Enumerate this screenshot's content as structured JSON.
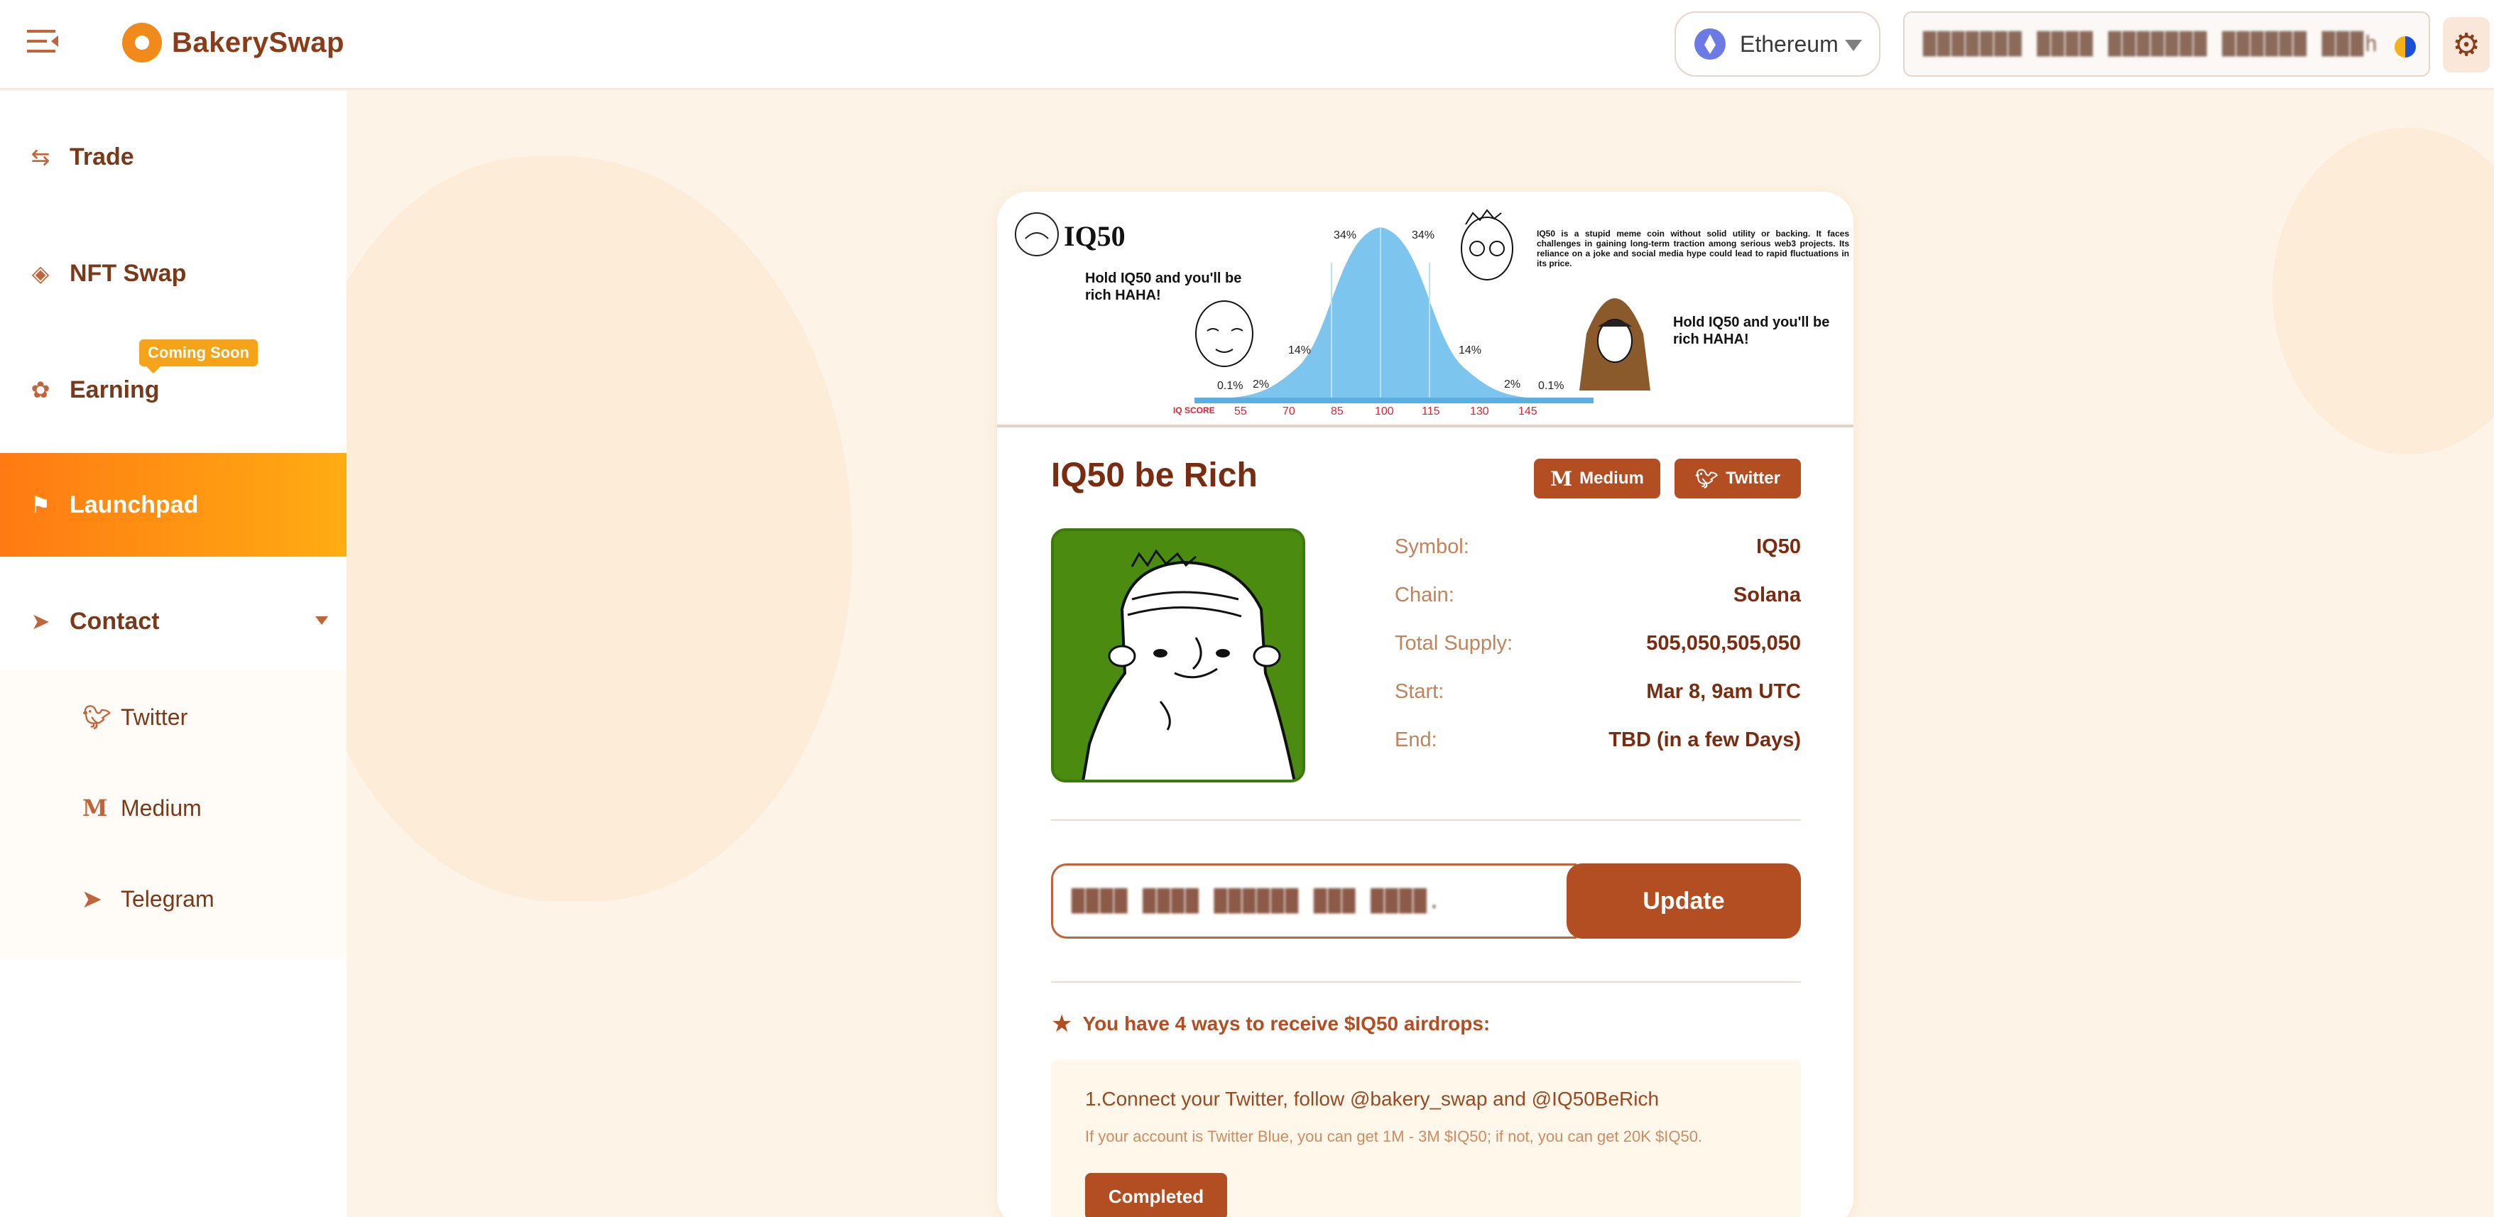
{
  "header": {
    "brand": "BakerySwap",
    "chain": "Ethereum",
    "wallet_address": "███████ ████ ███████ ██████ ███h"
  },
  "sidebar": {
    "items": [
      {
        "label": "Trade",
        "icon": "swap-icon"
      },
      {
        "label": "NFT Swap",
        "icon": "nft-icon"
      },
      {
        "label": "Earning",
        "icon": "earning-icon",
        "badge": "Coming Soon"
      },
      {
        "label": "Launchpad",
        "icon": "flag-icon"
      },
      {
        "label": "Contact",
        "icon": "send-icon"
      }
    ],
    "contact_links": [
      {
        "label": "Twitter",
        "icon": "twitter-icon"
      },
      {
        "label": "Medium",
        "icon": "medium-icon"
      },
      {
        "label": "Telegram",
        "icon": "telegram-icon"
      }
    ]
  },
  "banner": {
    "brand": "IQ50",
    "left_caption": "Hold IQ50 and you'll be rich HAHA!",
    "right_caption": "Hold IQ50 and you'll be rich HAHA!",
    "disclaimer": "IQ50 is a stupid meme coin without solid utility or backing. It faces challenges in gaining long-term traction among serious web3 projects. Its reliance on a joke and social media hype could lead to rapid fluctuations in its price.",
    "axis_label": "IQ SCORE",
    "ticks": [
      "55",
      "70",
      "85",
      "100",
      "115",
      "130",
      "145"
    ],
    "percents": [
      "0.1%",
      "2%",
      "14%",
      "34%",
      "34%",
      "14%",
      "2%",
      "0.1%"
    ]
  },
  "project": {
    "title": "IQ50 be Rich",
    "medium_label": "Medium",
    "twitter_label": "Twitter",
    "info": [
      {
        "key": "Symbol:",
        "value": "IQ50"
      },
      {
        "key": "Chain:",
        "value": "Solana"
      },
      {
        "key": "Total Supply:",
        "value": "505,050,505,050"
      },
      {
        "key": "Start:",
        "value": "Mar 8, 9am UTC"
      },
      {
        "key": "End:",
        "value": "TBD (in a few Days)"
      }
    ],
    "address_value": "████ ████ ██████ ███ ████.",
    "update_label": "Update",
    "airdrop_heading": "You have 4 ways to receive $IQ50 airdrops:",
    "tasks": [
      {
        "title": "1.Connect your Twitter, follow @bakery_swap and @IQ50BeRich",
        "note": "If your account is Twitter Blue, you can get 1M - 3M $IQ50; if not, you can get 20K $IQ50.",
        "status": "Completed"
      }
    ]
  },
  "colors": {
    "accent": "#b24e22",
    "active_nav_start": "#ff7a12",
    "active_nav_end": "#ffac12",
    "badge": "#f5a318",
    "page_bg": "#fdf3e6"
  }
}
